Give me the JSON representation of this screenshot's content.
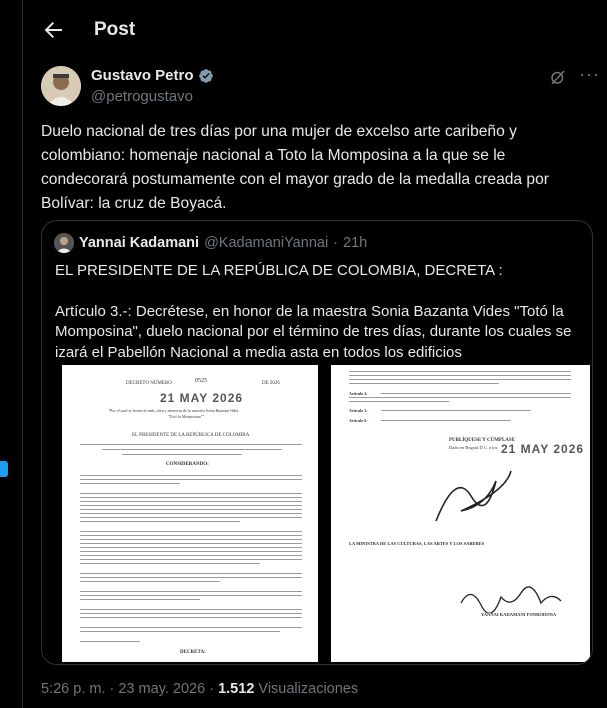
{
  "header": {
    "title": "Post",
    "back_icon": "arrow-left-icon"
  },
  "author": {
    "name": "Gustavo Petro",
    "handle": "@petrogustavo",
    "verified_color": "#829aab"
  },
  "post": {
    "text": "Duelo nacional de tres días por una mujer de excelso arte caribeño y colombiano: homenaje nacional a Toto la Momposina a la que se le condecorará postumamente con el mayor grado de la medalla creada por Bolívar: la cruz de Boyacá."
  },
  "quote": {
    "name": "Yannai Kadamani",
    "handle": "@KadamaniYannai",
    "separator": "·",
    "time": "21h",
    "paragraph1": "EL PRESIDENTE DE LA REPÚBLICA DE COLOMBIA, DECRETA :",
    "paragraph2": "Artículo 3.-: Decrétese, en honor de la maestra Sonia Bazanta Vides \"Totó la Momposina\", duelo nacional por el término de tres días, durante los cuales se izará el Pabellón Nacional a media asta en todos los edificios"
  },
  "doc1": {
    "decreto_label": "DECRETO NÚMERO",
    "decreto_num": "0525",
    "year_label": "DE 2026",
    "stamp_date": "21 MAY 2026",
    "caption": "\"Por el cual se honra la vida, obra y memoria de la maestra Sonia Bazanta Vides",
    "caption2": "\"Totó la Momposina\"\"",
    "president": "EL PRESIDENTE DE LA REPÚBLICA DE COLOMBIA",
    "considerando": "CONSIDERANDO:",
    "decreta": "DECRETA:"
  },
  "doc2": {
    "art4": "Artículo 4.-",
    "art5": "Artículo 5.-",
    "art6": "Artículo 6.-",
    "publiquese": "PUBLÍQUESE Y CÚMPLASE",
    "dado": "Dado en Bogotá D.C. a los",
    "stamp_date": "21 MAY 2026",
    "ministra": "LA MINISTRA DE LAS CULTURAS, LAS ARTES Y LOS SABERES",
    "firmante": "YANNAI KADAMANI FONRODONA"
  },
  "footer": {
    "time": "5:26 p. m.",
    "sep": "·",
    "date": "23 may. 2026",
    "views_count": "1.512",
    "views_label": "Visualizaciones"
  },
  "colors": {
    "accent": "#1d9bf0",
    "muted": "#71767b",
    "text": "#e7e9ea",
    "border": "#2f3336"
  }
}
